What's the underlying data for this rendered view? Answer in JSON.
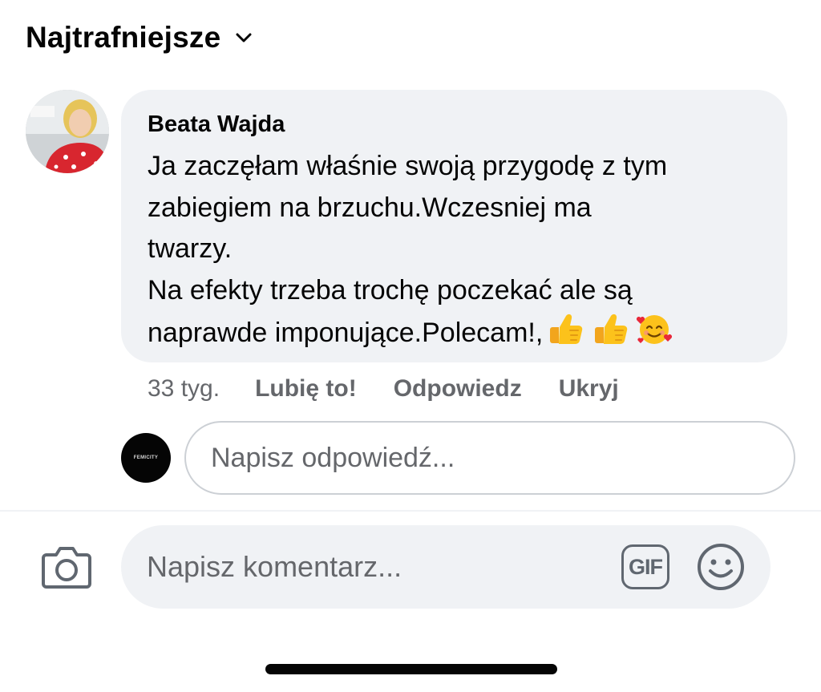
{
  "sort": {
    "label": "Najtrafniejsze",
    "icon": "chevron-down-icon"
  },
  "comment": {
    "author": "Beata Wajda",
    "text": "Ja zaczęłam właśnie swoją przygodę z tym\nzabiegiem na brzuchu.Wczesniej ma\ntwarzy.\nNa efekty trzeba trochę poczekać ale są\nnaprawde imponujące.Polecam!,",
    "emojis": [
      "thumbs-up-emoji",
      "thumbs-up-emoji",
      "smiling-face-with-hearts-emoji"
    ],
    "time": "33 tyg.",
    "actions": {
      "like": "Lubię to!",
      "reply": "Odpowiedz",
      "hide": "Ukryj"
    }
  },
  "reply": {
    "placeholder": "Napisz odpowiedź...",
    "avatar_text": "FEMICITY"
  },
  "composer": {
    "placeholder": "Napisz komentarz...",
    "camera_icon": "camera-icon",
    "gif_label": "GIF",
    "emoji_icon": "smiley-icon"
  },
  "colors": {
    "bubble": "#f0f2f5",
    "secondary_text": "#65676b",
    "primary_text": "#050505",
    "input_border": "#ccd0d5"
  }
}
